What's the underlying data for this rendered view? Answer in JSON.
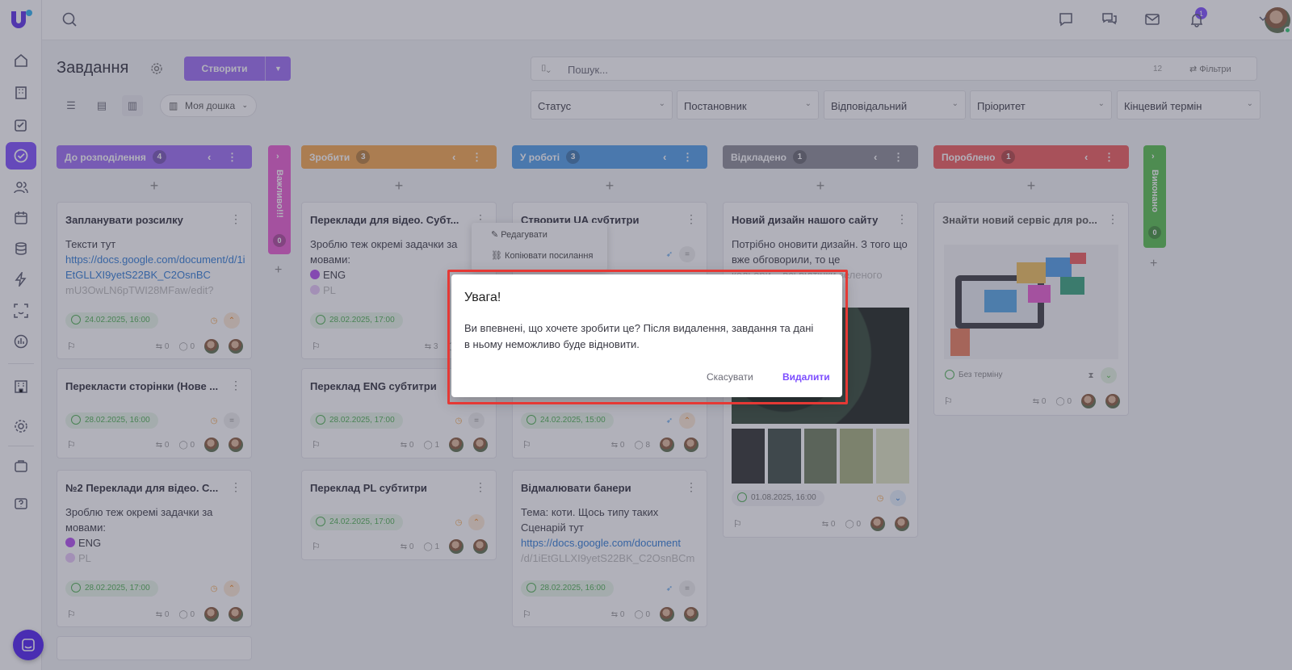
{
  "app": {
    "title": "Завдання",
    "create_label": "Створити",
    "search_placeholder": "Пошук...",
    "search_count": "12",
    "filters_label": "Фільтри",
    "board_label": "Моя дошка",
    "mail_badge": "1"
  },
  "filters": [
    "Статус",
    "Постановник",
    "Відповідальний",
    "Пріоритет",
    "Кінцевий термін"
  ],
  "columns": [
    {
      "title": "До розподілення",
      "count": "4",
      "color": "#9c6cf5"
    },
    {
      "title": "Зробити",
      "count": "3",
      "color": "#f4a64a"
    },
    {
      "title": "У роботі",
      "count": "3",
      "color": "#4f9de8"
    },
    {
      "title": "Відкладено",
      "count": "1",
      "color": "#8a8a94"
    },
    {
      "title": "Пороблено",
      "count": "1",
      "color": "#ef5a5a"
    }
  ],
  "vcols": {
    "important": {
      "title": "Важливо!!!",
      "count": "0",
      "color": "#e95bd0"
    },
    "done": {
      "title": "Виконано",
      "count": "0",
      "color": "#55c04a"
    }
  },
  "cards": {
    "c1": {
      "title": "Запланувати розсилку",
      "desc": "Тексти тут",
      "link": "https://docs.google.com/document/d/1iEtGLLXI9yetS22BK_C2OsnBC",
      "link_fade": "mU3OwLN6pTWI28MFaw/edit?",
      "date": "24.02.2025, 16:00",
      "c1": "0",
      "c2": "0"
    },
    "c2": {
      "title": "Перекласти сторінки (Нове ...",
      "date": "28.02.2025, 16:00",
      "c1": "0",
      "c2": "0"
    },
    "c3": {
      "title": "№2 Переклади для відео. С...",
      "desc": "Зроблю теж окремі задачки за мовами:",
      "l1": "ENG",
      "l2": "PL",
      "date": "28.02.2025, 17:00",
      "c1": "0",
      "c2": "0"
    },
    "c4": {
      "title": "Переклади для відео. Субт...",
      "desc": "Зроблю теж окремі задачки за мовами:",
      "l1": "ENG",
      "l2": "PL",
      "date": "28.02.2025, 17:00",
      "c1": "3",
      "c2": "0"
    },
    "c5": {
      "title": "Переклад ENG субтитри",
      "date": "28.02.2025, 17:00",
      "c1": "0",
      "c2": "1"
    },
    "c6": {
      "title": "Переклад PL субтитри",
      "date": "24.02.2025, 17:00",
      "c1": "0",
      "c2": "1"
    },
    "c7": {
      "title": "Створити UA субтитри"
    },
    "c8": {
      "date": "24.02.2025, 15:00",
      "c1": "0",
      "c2": "8"
    },
    "c9": {
      "title": "Відмалювати банери",
      "desc": "Тема: коти. Щось типу таких Сценарій тут",
      "link": "https://docs.google.com/document",
      "link_fade": "/d/1iEtGLLXI9yetS22BK_C2OsnBCm",
      "date": "28.02.2025, 16:00",
      "c1": "0",
      "c2": "0"
    },
    "c10": {
      "title": "Новий дизайн нашого сайту",
      "desc": "Потрібно оновити дизайн. З того що вже обговорили, то це",
      "fade": "кольори – всі відтінки зеленого",
      "date": "01.08.2025, 16:00",
      "c1": "0",
      "c2": "0"
    },
    "c11": {
      "title": "Знайти новий сервіс для ро...",
      "date": "Без терміну",
      "c1": "0",
      "c2": "0"
    }
  },
  "menu": {
    "edit": "Редагувати",
    "copy": "Копіювати посилання"
  },
  "modal": {
    "title": "Увага!",
    "body": "Ви впевнені, що хочете зробити це? Після видалення, завдання та дані в ньому неможливо буде відновити.",
    "cancel": "Скасувати",
    "delete": "Видалити"
  }
}
